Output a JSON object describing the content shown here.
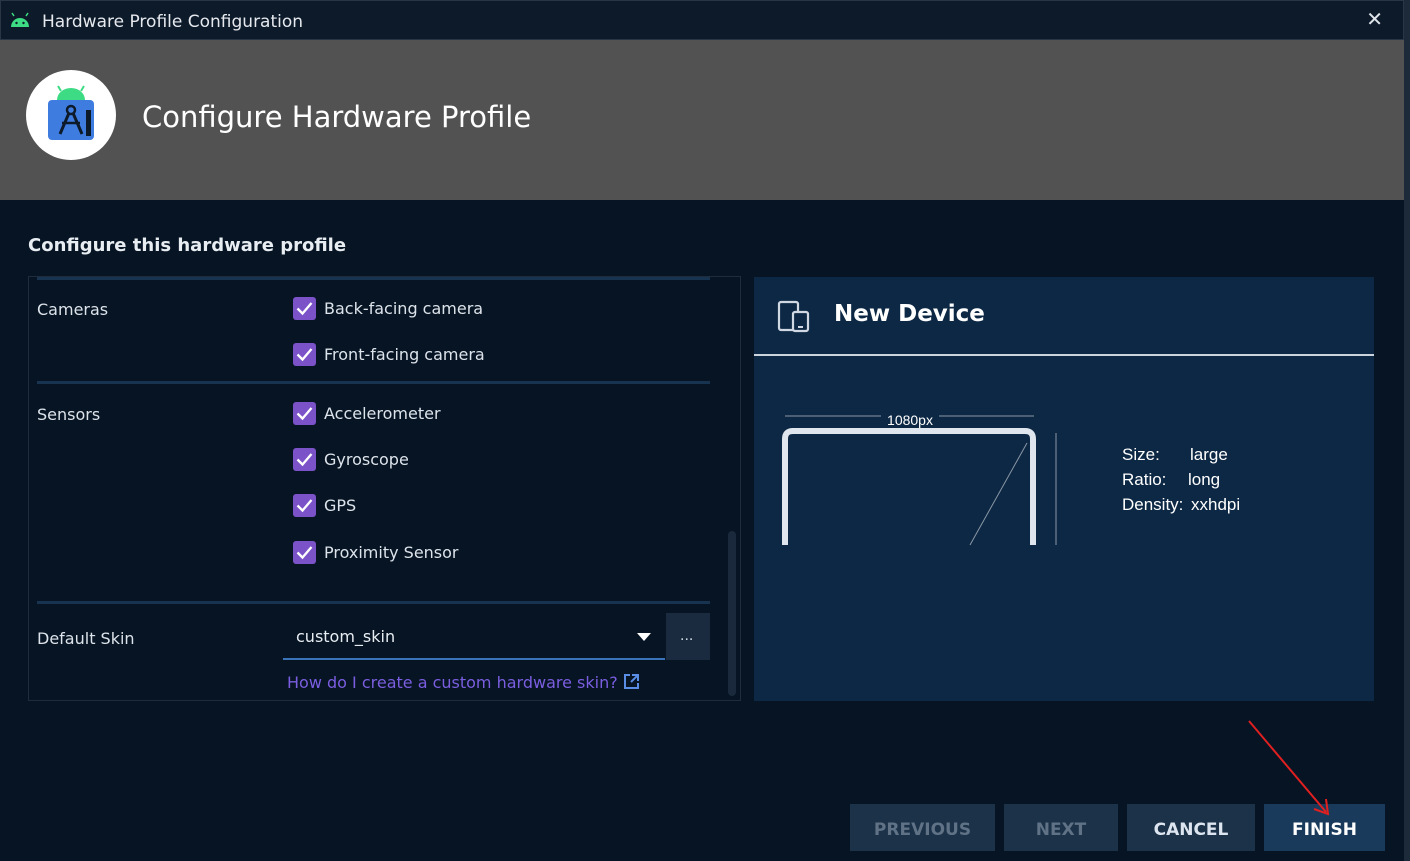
{
  "window": {
    "title": "Hardware Profile Configuration",
    "close_glyph": "✕"
  },
  "header": {
    "title": "Configure Hardware Profile"
  },
  "section_title": "Configure this hardware profile",
  "form": {
    "cameras": {
      "label": "Cameras",
      "options": [
        {
          "label": "Back-facing camera",
          "checked": true
        },
        {
          "label": "Front-facing camera",
          "checked": true
        }
      ]
    },
    "sensors": {
      "label": "Sensors",
      "options": [
        {
          "label": "Accelerometer",
          "checked": true
        },
        {
          "label": "Gyroscope",
          "checked": true
        },
        {
          "label": "GPS",
          "checked": true
        },
        {
          "label": "Proximity Sensor",
          "checked": true
        }
      ]
    },
    "default_skin": {
      "label": "Default Skin",
      "value": "custom_skin",
      "browse_label": "...",
      "help_link": "How do I create a custom hardware skin?"
    }
  },
  "preview": {
    "device_name": "New Device",
    "width_label": "1080px",
    "specs": [
      {
        "key": "Size:",
        "value": "large"
      },
      {
        "key": "Ratio:",
        "value": "long"
      },
      {
        "key": "Density:",
        "value": "xxhdpi"
      }
    ]
  },
  "buttons": {
    "previous": "PREVIOUS",
    "next": "NEXT",
    "cancel": "CANCEL",
    "finish": "FINISH"
  },
  "colors": {
    "checkbox": "#7b52c8",
    "link": "#7b5ee0",
    "annotation_arrow": "#e02020"
  }
}
